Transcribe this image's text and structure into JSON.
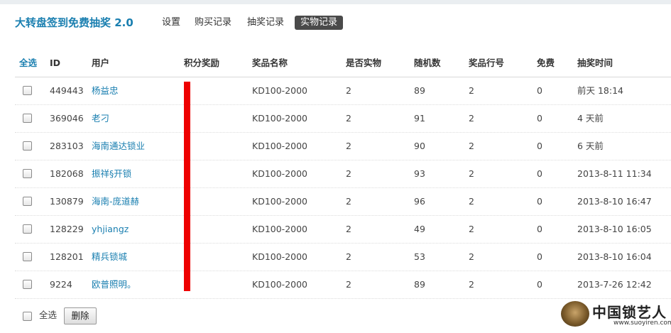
{
  "app": {
    "title": "大转盘签到免费抽奖 2.0"
  },
  "tabs": [
    {
      "label": "设置",
      "active": false
    },
    {
      "label": "购买记录",
      "active": false
    },
    {
      "label": "抽奖记录",
      "active": false
    },
    {
      "label": "实物记录",
      "active": true
    }
  ],
  "table": {
    "columns": {
      "select_all": "全选",
      "id": "ID",
      "user": "用户",
      "points": "积分奖励",
      "prize_name": "奖品名称",
      "is_physical": "是否实物",
      "random": "随机数",
      "prize_row": "奖品行号",
      "free": "免费",
      "draw_time": "抽奖时间"
    },
    "rows": [
      {
        "id": "449443",
        "user": "杨益忠",
        "prize_name": "KD100-2000",
        "is_physical": "2",
        "random": "89",
        "prize_row": "2",
        "free": "0",
        "draw_time": "前天 18:14"
      },
      {
        "id": "369046",
        "user": "老刁",
        "prize_name": "KD100-2000",
        "is_physical": "2",
        "random": "91",
        "prize_row": "2",
        "free": "0",
        "draw_time": "4 天前"
      },
      {
        "id": "283103",
        "user": "海南通达锁业",
        "prize_name": "KD100-2000",
        "is_physical": "2",
        "random": "90",
        "prize_row": "2",
        "free": "0",
        "draw_time": "6 天前"
      },
      {
        "id": "182068",
        "user": "振祥§开锁",
        "prize_name": "KD100-2000",
        "is_physical": "2",
        "random": "93",
        "prize_row": "2",
        "free": "0",
        "draw_time": "2013-8-11 11:34"
      },
      {
        "id": "130879",
        "user": "海南-庞道赫",
        "prize_name": "KD100-2000",
        "is_physical": "2",
        "random": "96",
        "prize_row": "2",
        "free": "0",
        "draw_time": "2013-8-10 16:47"
      },
      {
        "id": "128229",
        "user": "yhjiangz",
        "prize_name": "KD100-2000",
        "is_physical": "2",
        "random": "49",
        "prize_row": "2",
        "free": "0",
        "draw_time": "2013-8-10 16:05"
      },
      {
        "id": "128201",
        "user": "精兵锁城",
        "prize_name": "KD100-2000",
        "is_physical": "2",
        "random": "53",
        "prize_row": "2",
        "free": "0",
        "draw_time": "2013-8-10 16:04"
      },
      {
        "id": "9224",
        "user": "欧普照明。",
        "prize_name": "KD100-2000",
        "is_physical": "2",
        "random": "89",
        "prize_row": "2",
        "free": "0",
        "draw_time": "2013-7-26 12:42"
      }
    ]
  },
  "footer": {
    "select_all_label": "全选",
    "delete_label": "删除"
  },
  "watermark": {
    "text": "中国锁艺人",
    "url": "www.suoyiren.com"
  },
  "colors": {
    "accent": "#1a7fb0",
    "active_tab_bg": "#4a4a4a",
    "redaction": "#ee0000"
  }
}
